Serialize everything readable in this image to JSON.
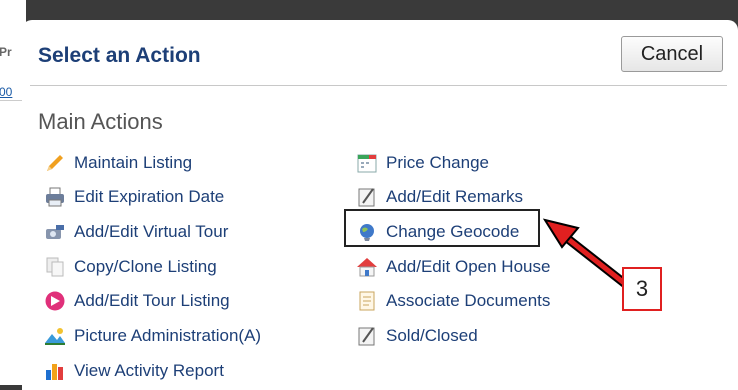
{
  "background": {
    "fragment_top": "Pr",
    "fragment_link": "00"
  },
  "dialog": {
    "title": "Select an Action",
    "cancel_label": "Cancel",
    "section_title": "Main Actions"
  },
  "actions_left": [
    {
      "label": "Maintain Listing",
      "icon": "pencil-icon"
    },
    {
      "label": "Edit Expiration Date",
      "icon": "printer-icon"
    },
    {
      "label": "Add/Edit Virtual Tour",
      "icon": "camera-icon"
    },
    {
      "label": "Copy/Clone Listing",
      "icon": "copy-icon"
    },
    {
      "label": "Add/Edit Tour Listing",
      "icon": "tour-icon"
    },
    {
      "label": "Picture Administration(A)",
      "icon": "picture-icon"
    },
    {
      "label": "View Activity Report",
      "icon": "bar-chart-icon"
    }
  ],
  "actions_right": [
    {
      "label": "Price Change",
      "icon": "calendar-icon"
    },
    {
      "label": "Add/Edit Remarks",
      "icon": "note-icon"
    },
    {
      "label": "Change Geocode",
      "icon": "globe-icon"
    },
    {
      "label": "Add/Edit Open House",
      "icon": "house-icon"
    },
    {
      "label": "Associate Documents",
      "icon": "document-icon"
    },
    {
      "label": "Sold/Closed",
      "icon": "note-icon"
    }
  ],
  "annotation": {
    "step_number": "3",
    "color": "#e02020"
  }
}
